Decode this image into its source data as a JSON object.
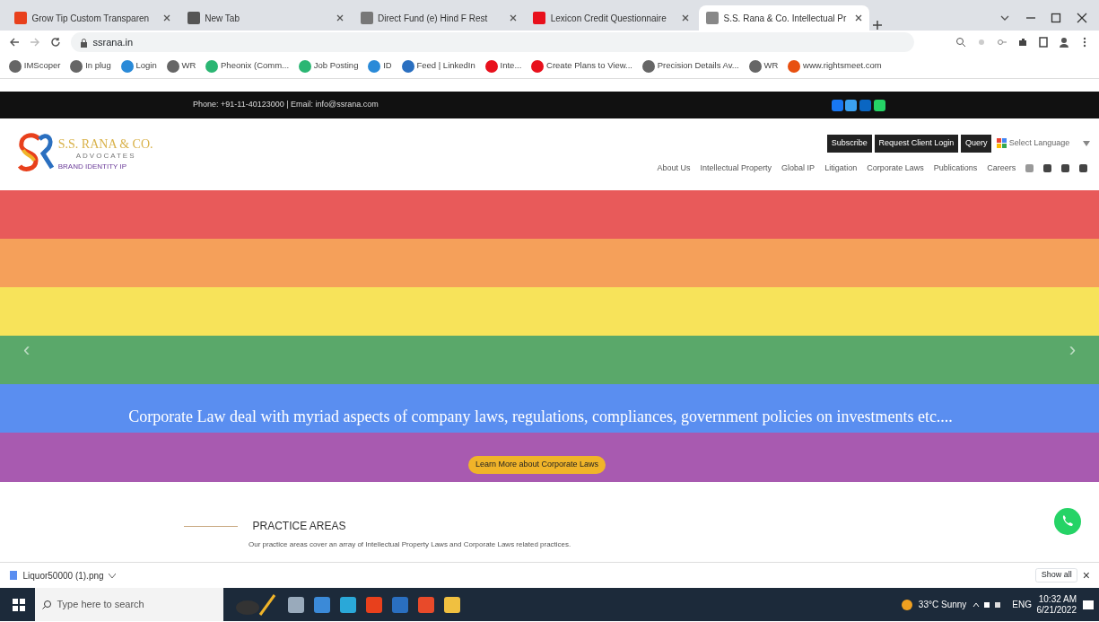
{
  "browser": {
    "tabs": [
      {
        "title": "Grow Tip Custom Transparen",
        "selected": false,
        "color": "#e8401c"
      },
      {
        "title": "New Tab",
        "selected": false,
        "color": "#555555"
      },
      {
        "title": "Direct Fund (e) Hind F Rest",
        "selected": false,
        "color": "#777777"
      },
      {
        "title": "Lexicon Credit Questionnaire",
        "selected": false,
        "color": "#e8101c"
      },
      {
        "title": "S.S. Rana & Co. Intellectual Pr",
        "selected": true,
        "color": "#888888"
      }
    ],
    "address": "ssrana.in",
    "bookmarks": [
      {
        "label": "IMScoper",
        "color": "#666666"
      },
      {
        "label": "In plug",
        "color": "#666666"
      },
      {
        "label": "Login",
        "color": "#2a8ad8"
      },
      {
        "label": "WR",
        "color": "#666666"
      },
      {
        "label": "Pheonix (Comm...",
        "color": "#2bb673"
      },
      {
        "label": "Job Posting",
        "color": "#2bb673"
      },
      {
        "label": "ID",
        "color": "#2a8ad8"
      },
      {
        "label": "Feed | LinkedIn",
        "color": "#2a6fc0"
      },
      {
        "label": "Inte...",
        "color": "#e8101c"
      },
      {
        "label": "Create Plans to View...",
        "color": "#e8101c"
      },
      {
        "label": "Precision Details Av...",
        "color": "#666666"
      },
      {
        "label": "WR",
        "color": "#666666"
      },
      {
        "label": "www.rightsmeet.com",
        "color": "#e85010"
      }
    ]
  },
  "site": {
    "contact": "Phone: +91-11-40123000  |  Email: info@ssrana.com",
    "social": [
      {
        "color": "#1877f2"
      },
      {
        "color": "#3ba1f0"
      },
      {
        "color": "#0a66c2"
      },
      {
        "color": "#25d366"
      }
    ],
    "top_buttons": [
      "Subscribe",
      "Request Client Login",
      "Query"
    ],
    "language": "Select Language",
    "logo": {
      "name": "S.S. RANA & CO.",
      "tagline": "ADVOCATES",
      "motto": "BRAND IDENTITY IP"
    },
    "nav": [
      "About Us",
      "Intellectual Property",
      "Global IP",
      "Litigation",
      "Corporate Laws",
      "Publications",
      "Careers"
    ],
    "hero": {
      "text": "Corporate Law deal with myriad aspects of company laws, regulations, compliances, government policies on investments etc....",
      "button": "Learn More about Corporate Laws",
      "prev": "‹",
      "next": "›"
    },
    "practice": {
      "heading": "PRACTICE AREAS",
      "text": "Our practice areas cover an array of Intellectual Property Laws and Corporate Laws related practices."
    }
  },
  "downloads": {
    "file": "Liquor50000 (1).png",
    "show_all": "Show all",
    "close": "×"
  },
  "taskbar": {
    "search_placeholder": "Type here to search",
    "weather": "33°C Sunny",
    "lang": "ENG",
    "time": "10:32 AM",
    "date": "6/21/2022"
  }
}
